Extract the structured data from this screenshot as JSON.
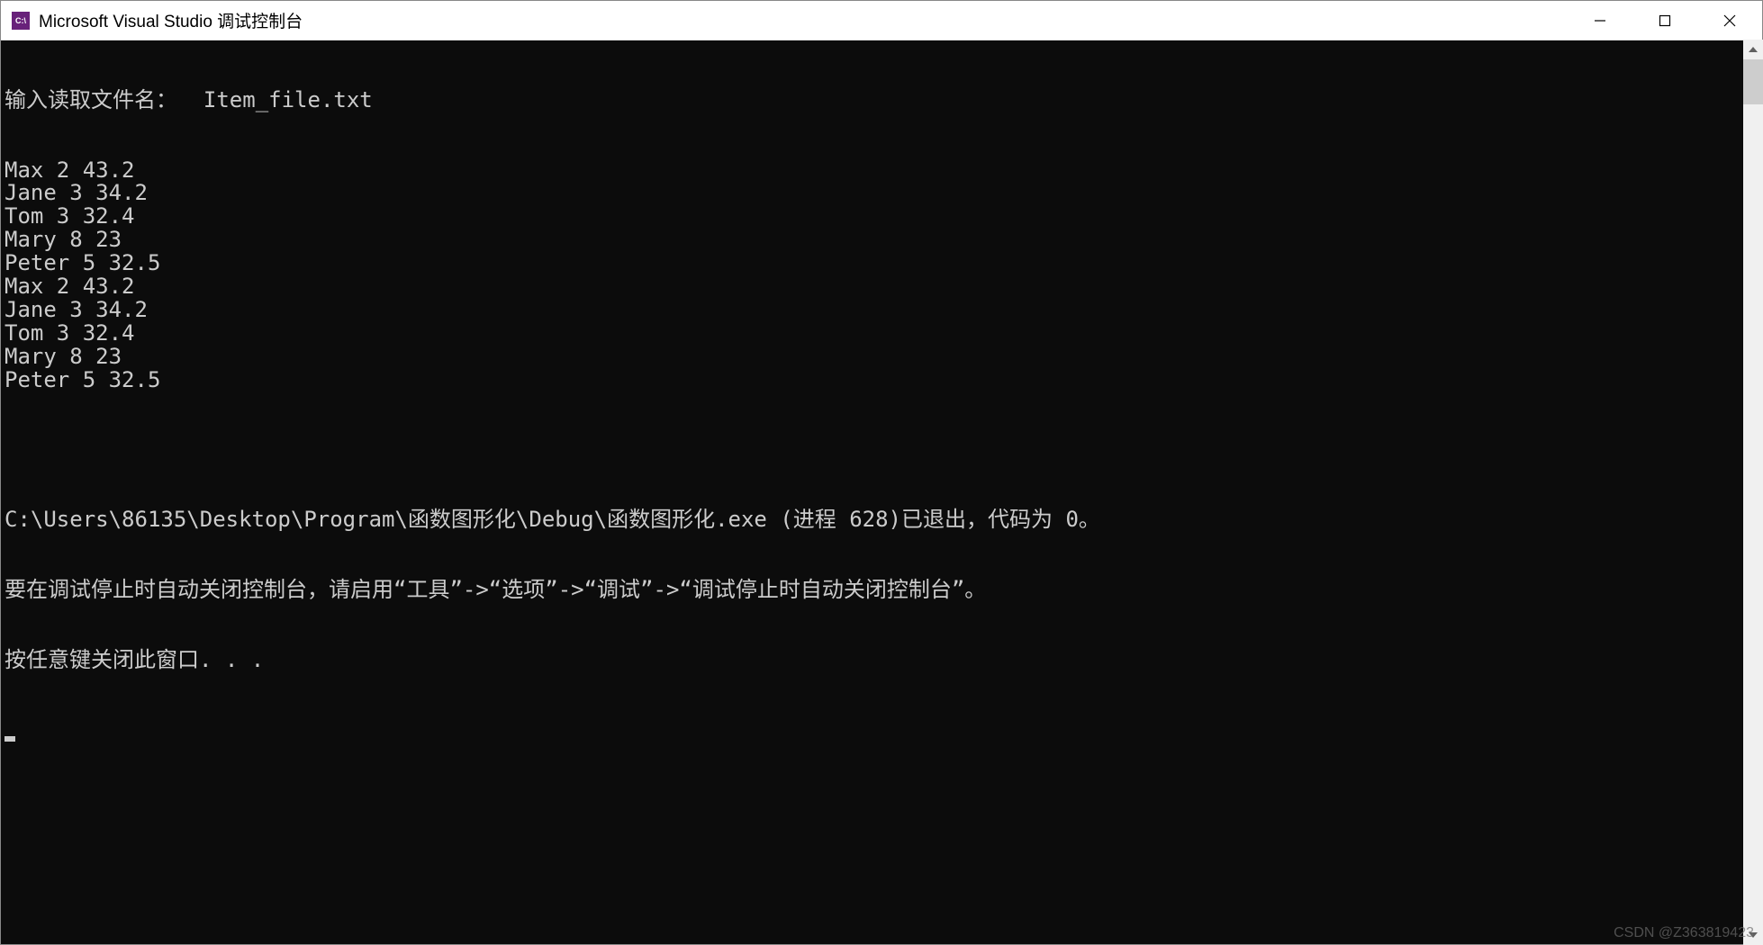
{
  "window": {
    "title": "Microsoft Visual Studio 调试控制台",
    "icon_label": "C:\\"
  },
  "console": {
    "prompt_line": "输入读取文件名：  Item_file.txt",
    "data_lines": [
      "Max 2 43.2",
      "Jane 3 34.2",
      "Tom 3 32.4",
      "Mary 8 23",
      "Peter 5 32.5",
      "Max 2 43.2",
      "Jane 3 34.2",
      "Tom 3 32.4",
      "Mary 8 23",
      "Peter 5 32.5"
    ],
    "exit_line": "C:\\Users\\86135\\Desktop\\Program\\函数图形化\\Debug\\函数图形化.exe (进程 628)已退出，代码为 0。",
    "hint_line": "要在调试停止时自动关闭控制台，请启用“工具”->“选项”->“调试”->“调试停止时自动关闭控制台”。",
    "close_line": "按任意键关闭此窗口. . ."
  },
  "watermark": "CSDN @Z363819423"
}
